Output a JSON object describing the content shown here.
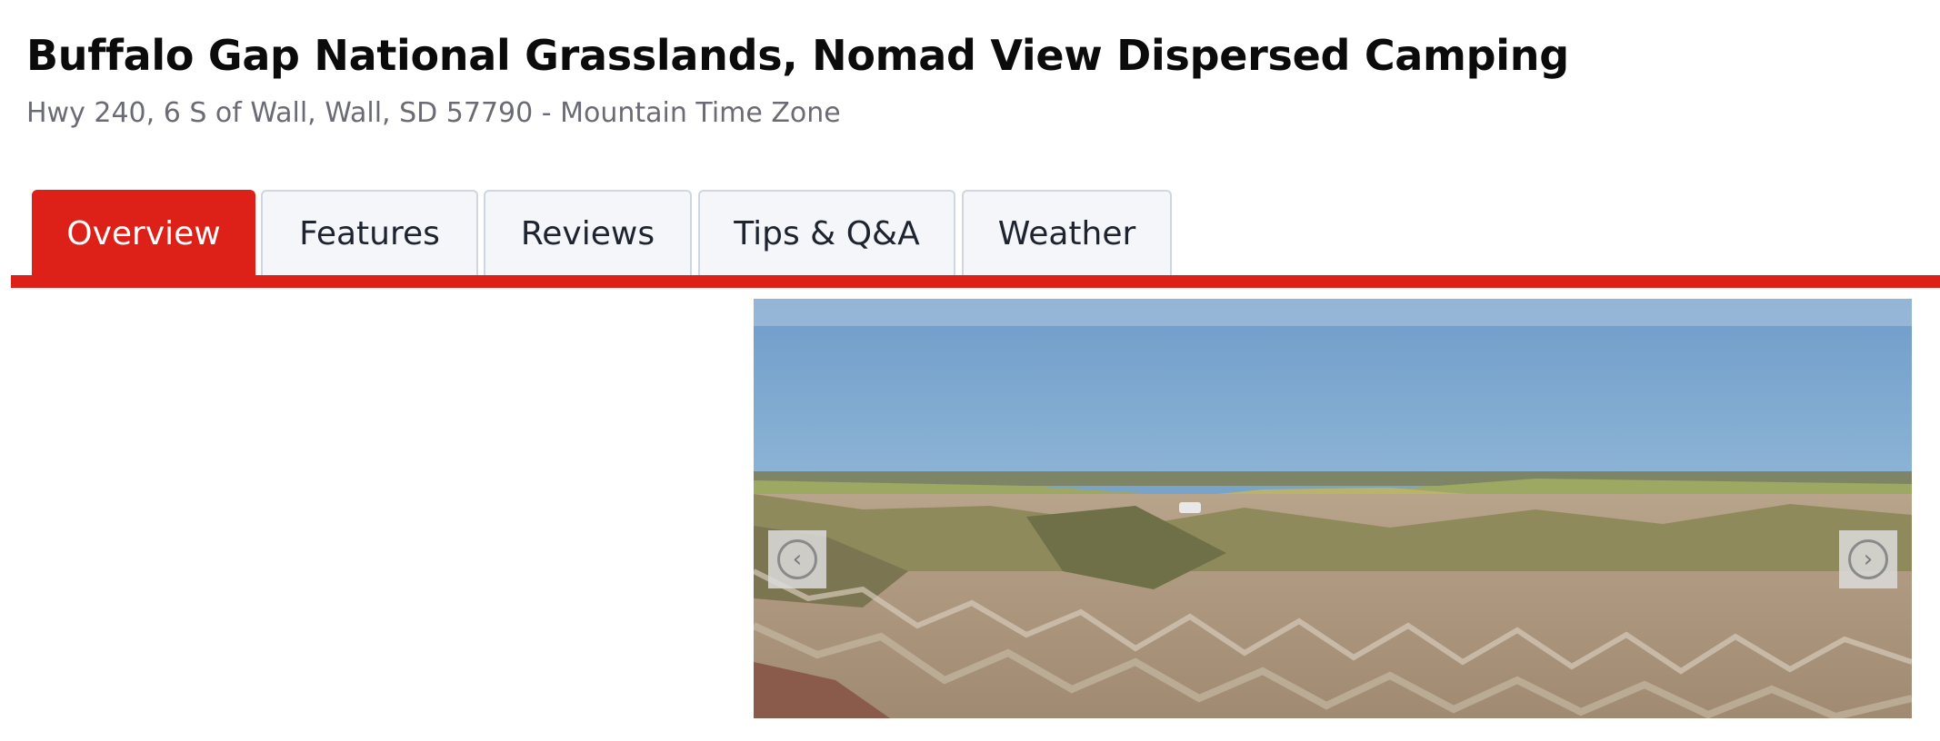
{
  "header": {
    "title": "Buffalo Gap National Grasslands, Nomad View Dispersed Camping",
    "address": "Hwy 240, 6 S of Wall, Wall, SD 57790 - Mountain Time Zone"
  },
  "tabs": [
    {
      "label": "Overview",
      "active": true
    },
    {
      "label": "Features",
      "active": false
    },
    {
      "label": "Reviews",
      "active": false
    },
    {
      "label": "Tips & Q&A",
      "active": false
    },
    {
      "label": "Weather",
      "active": false
    }
  ],
  "gallery": {
    "prev_icon": "chevron-left-circle-icon",
    "prev_glyph": "‹",
    "next_icon": "chevron-right-circle-icon",
    "next_glyph": "›"
  },
  "colors": {
    "accent": "#dd2118",
    "tab_bg": "#f4f6fa",
    "tab_border": "#cfd6e2",
    "title": "#0b0b0b",
    "subtitle": "#6b6b75"
  }
}
